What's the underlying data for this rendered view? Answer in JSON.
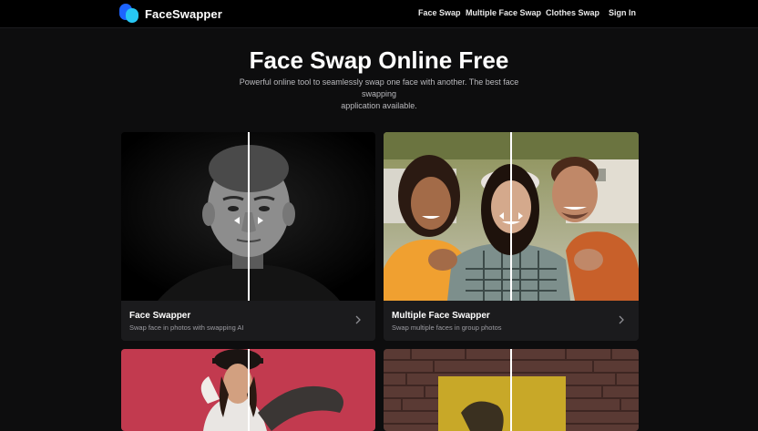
{
  "header": {
    "logo_text": "FaceSwapper",
    "nav": [
      "Face Swap",
      "Multiple Face Swap",
      "Clothes Swap"
    ],
    "sign_in": "Sign In"
  },
  "hero": {
    "title": "Face Swap Online Free",
    "subtitle_line1": "Powerful online tool to seamlessly swap one face with another. The best face swapping",
    "subtitle_line2": "application available."
  },
  "cards": [
    {
      "title": "Face Swapper",
      "description": "Swap face in photos with swapping AI",
      "icon": "chevron-right-icon"
    },
    {
      "title": "Multiple Face Swapper",
      "description": "Swap multiple faces in group photos",
      "icon": "chevron-right-icon"
    }
  ],
  "colors": {
    "background": "#0d0d0e",
    "card": "#1b1b1d",
    "logo_blue": "#1d64ff",
    "logo_cyan": "#27c7f4"
  }
}
